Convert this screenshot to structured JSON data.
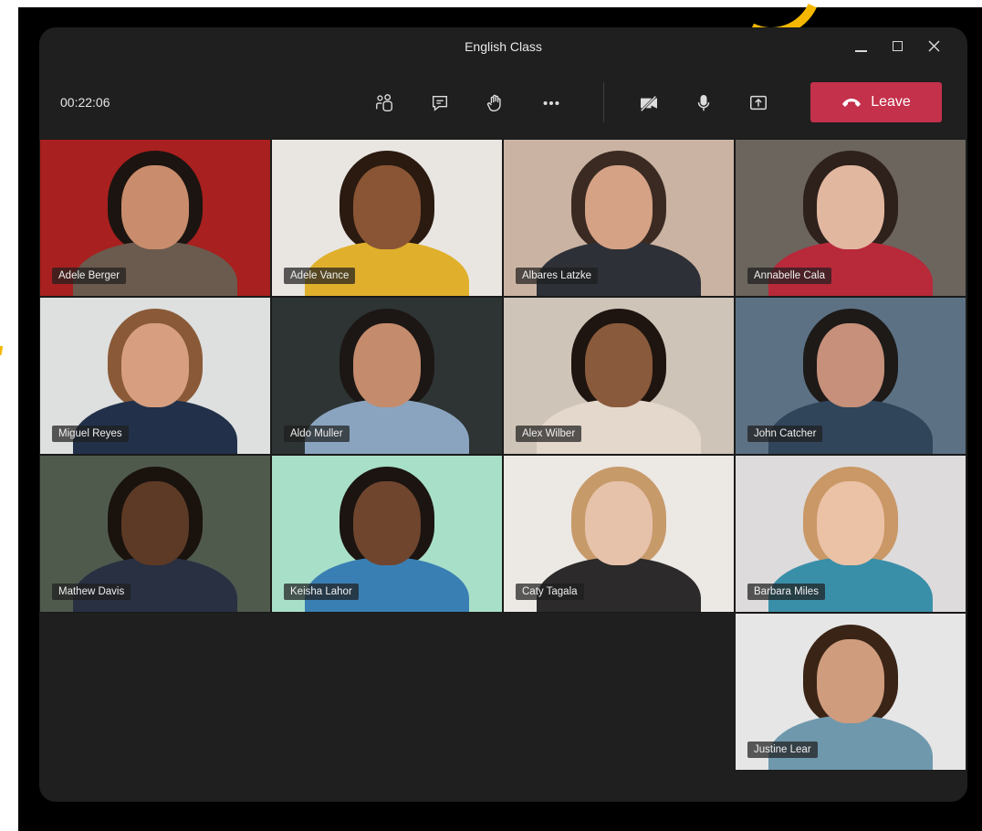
{
  "window": {
    "title": "English Class",
    "controls": [
      "minimize-icon",
      "maximize-icon",
      "close-icon"
    ]
  },
  "toolbar": {
    "timer": "00:22:06",
    "icons": [
      "people-icon",
      "chat-icon",
      "raise-hand-icon",
      "more-icon",
      "camera-off-icon",
      "microphone-icon",
      "share-screen-icon"
    ],
    "leave_label": "Leave",
    "leave_color": "#c4314b"
  },
  "participants": [
    {
      "name": "Adele Berger",
      "bg": "#a8201f",
      "skin": "#c98d6d",
      "hair": "#1c1410",
      "shirt": "#6b5a4e"
    },
    {
      "name": "Adele Vance",
      "bg": "#e9e6e2",
      "skin": "#8a5535",
      "hair": "#2a1a10",
      "shirt": "#e0b02c"
    },
    {
      "name": "Albares Latzke",
      "bg": "#cbb3a3",
      "skin": "#d5a285",
      "hair": "#3a2a22",
      "shirt": "#2d3036"
    },
    {
      "name": "Annabelle Cala",
      "bg": "#6c655e",
      "skin": "#e2b7a0",
      "hair": "#2e211b",
      "shirt": "#b8293a"
    },
    {
      "name": "Miguel Reyes",
      "bg": "#dedfdf",
      "skin": "#d79f80",
      "hair": "#8a5a38",
      "shirt": "#22304a"
    },
    {
      "name": "Aldo Muller",
      "bg": "#2e3434",
      "skin": "#c48b6c",
      "hair": "#1c1714",
      "shirt": "#8aa4c0"
    },
    {
      "name": "Alex Wilber",
      "bg": "#cfc4b8",
      "skin": "#8a5a3c",
      "hair": "#1e1510",
      "shirt": "#e4d8cc"
    },
    {
      "name": "John Catcher",
      "bg": "#5d7184",
      "skin": "#c6907a",
      "hair": "#1d1a18",
      "shirt": "#30445a"
    },
    {
      "name": "Mathew Davis",
      "bg": "#4f5a4d",
      "skin": "#5d3a26",
      "hair": "#1a120d",
      "shirt": "#283042"
    },
    {
      "name": "Keisha Lahor",
      "bg": "#a8dfc8",
      "skin": "#6f452e",
      "hair": "#1b1410",
      "shirt": "#3a7fb3"
    },
    {
      "name": "Caty Tagala",
      "bg": "#ece8e4",
      "skin": "#e7c2aa",
      "hair": "#c79a6a",
      "shirt": "#2c2a2a"
    },
    {
      "name": "Barbara Miles",
      "bg": "#dedbdc",
      "skin": "#ebc2a6",
      "hair": "#c99866",
      "shirt": "#3a8fa8"
    },
    {
      "name": "",
      "bg": "",
      "skin": "",
      "hair": "",
      "shirt": ""
    },
    {
      "name": "",
      "bg": "",
      "skin": "",
      "hair": "",
      "shirt": ""
    },
    {
      "name": "",
      "bg": "",
      "skin": "",
      "hair": "",
      "shirt": ""
    },
    {
      "name": "Justine Lear",
      "bg": "#e6e6e6",
      "skin": "#cf9c7d",
      "hair": "#3a2416",
      "shirt": "#6f98ad"
    }
  ]
}
